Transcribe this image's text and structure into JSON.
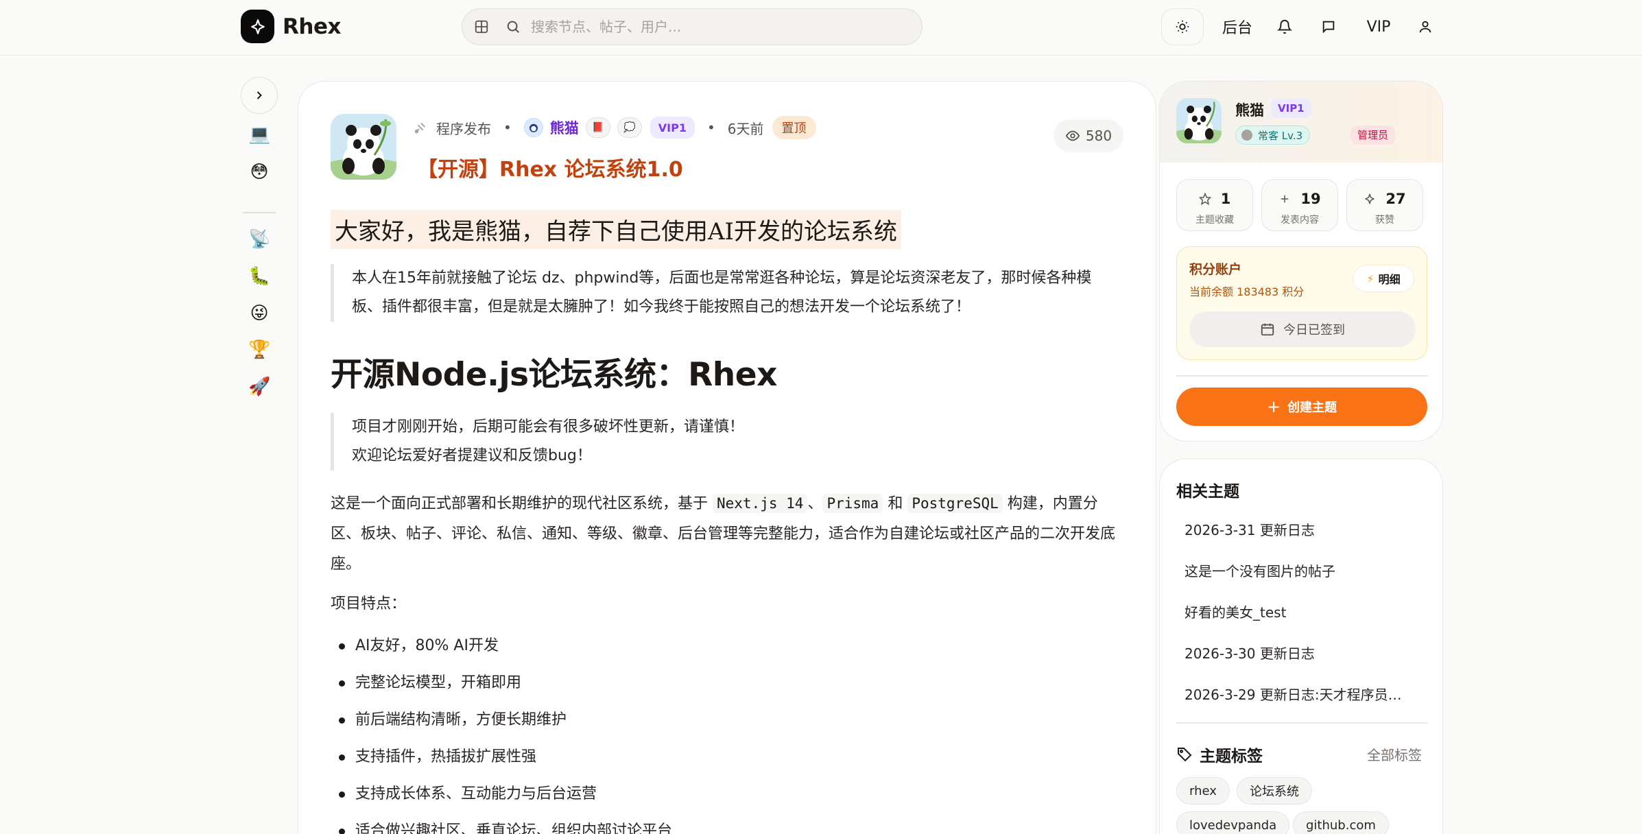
{
  "header": {
    "logo_text": "Rhex",
    "search_placeholder": "搜索节点、帖子、用户...",
    "admin_label": "后台",
    "vip_label": "VIP"
  },
  "sidebar_rail": {
    "icons": [
      "laptop-emoji-icon",
      "smile-emoji-icon",
      "satellite-emoji-icon",
      "caterpillar-emoji-icon",
      "grin-emoji-icon",
      "trophy-emoji-icon",
      "rocket-emoji-icon"
    ]
  },
  "post": {
    "category": "程序发布",
    "author": "熊猫",
    "vip": "VIP1",
    "time": "6天前",
    "pinned": "置顶",
    "title": "【开源】Rhex 论坛系统1.0",
    "views": "580",
    "intro_heading": "大家好，我是熊猫，自荐下自己使用AI开发的论坛系统",
    "quote1": "本人在15年前就接触了论坛 dz、phpwind等，后面也是常常逛各种论坛，算是论坛资深老友了，那时候各种模板、插件都很丰富，但是就是太臃肿了！如今我终于能按照自己的想法开发一个论坛系统了！",
    "h2": "开源Node.js论坛系统：Rhex",
    "quote2_line1": "项目才刚刚开始，后期可能会有很多破坏性更新，请谨慎！",
    "quote2_line2": "欢迎论坛爱好者提建议和反馈bug！",
    "para_pre": "这是一个面向正式部署和长期维护的现代社区系统，基于",
    "code1": "Next.js 14",
    "sep1": "、",
    "code2": "Prisma",
    "and": "和",
    "code3": "PostgreSQL",
    "para_post": "构建，内置分区、板块、帖子、评论、私信、通知、等级、徽章、后台管理等完整能力，适合作为自建论坛或社区产品的二次开发底座。",
    "features_label": "项目特点：",
    "features": [
      "AI友好，80% AI开发",
      "完整论坛模型，开箱即用",
      "前后端结构清晰，方便长期维护",
      "支持插件，热插拔扩展性强",
      "支持成长体系、互动能力与后台运营",
      "适合做兴趣社区、垂直论坛、组织内部讨论平台"
    ]
  },
  "profile": {
    "name": "熊猫",
    "vip": "VIP1",
    "level": "常客 Lv.3",
    "role": "管理员",
    "stats": [
      {
        "value": "1",
        "label": "主题收藏"
      },
      {
        "value": "19",
        "label": "发表内容"
      },
      {
        "value": "27",
        "label": "获赞"
      }
    ],
    "points_title": "积分账户",
    "points_balance": "当前余额 183483 积分",
    "points_detail": "明细",
    "signed_label": "今日已签到",
    "create_label": "创建主题"
  },
  "related": {
    "title": "相关主题",
    "items": [
      "2026-3-31 更新日志",
      "这是一个没有图片的帖子",
      "好看的美女_test",
      "2026-3-30 更新日志",
      "2026-3-29 更新日志:天才程序员…"
    ]
  },
  "tags": {
    "title": "主题标签",
    "all_label": "全部标签",
    "items": [
      "rhex",
      "论坛系统",
      "lovedevpanda",
      "github.com"
    ]
  },
  "colors": {
    "accent": "#f97316",
    "title": "#c2410c",
    "vip": "#7c3aed"
  }
}
